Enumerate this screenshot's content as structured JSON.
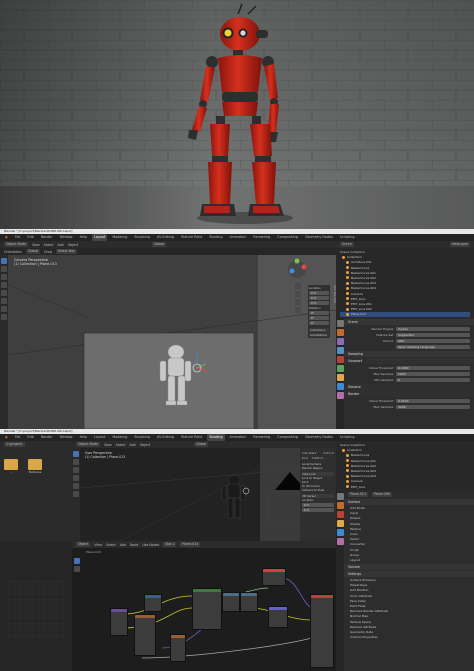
{
  "render_panel": {
    "colors": {
      "wall": "#666868",
      "robot": "#c4261a",
      "robot_dark": "#2e2e2e",
      "eye": "#f2d230"
    }
  },
  "window1": {
    "title": "Blender* [C:\\project\\Blender\\ROBO.W0.blend]",
    "menus": [
      "File",
      "Edit",
      "Render",
      "Window",
      "Help"
    ],
    "tabs": [
      "Layout",
      "Modeling",
      "Sculpting",
      "UV Editing",
      "Texture Paint",
      "Shading",
      "Animation",
      "Rendering",
      "Compositing",
      "Geometry Nodes",
      "Scripting"
    ],
    "active_tab": "Layout",
    "header": {
      "mode": "Object Mode",
      "view": "View",
      "select": "Select",
      "add": "Add",
      "object": "Object",
      "orientation": "Global"
    },
    "subheader": {
      "orientation": "Orientation",
      "default": "Global",
      "drag": "Drag",
      "select_box": "Select Box"
    },
    "viewport_overlay": {
      "line1": "Camera Perspective",
      "line2": "(1) Collection | Plane.013"
    },
    "outliner": {
      "header": "Scene Collection",
      "items": [
        "Collection",
        "Armature.001",
        "BezierCurve",
        "BezierCurve.001",
        "BezierCurve.002",
        "BezierCurve.003",
        "BezierCurve.004",
        "Camera",
        "EMT_Line",
        "EMT_Line.001",
        "EMT_Line.002",
        "Plane.013"
      ],
      "selected_index": 11
    },
    "scene_label": "Scene",
    "view_layer_label": "ViewLayer",
    "props": {
      "section": "Scene",
      "rows": [
        {
          "label": "Render Engine",
          "value": "Cycles"
        },
        {
          "label": "Feature Set",
          "value": "Supported"
        },
        {
          "label": "Device",
          "value": "GPU"
        },
        {
          "label": "",
          "value": "Open Shading Language"
        }
      ],
      "sampling": "Sampling",
      "viewport": "Viewport",
      "vrows": [
        {
          "label": "Noise Threshold",
          "value": "0.1000"
        },
        {
          "label": "Max Samples",
          "value": "1024"
        },
        {
          "label": "Min Samples",
          "value": "0"
        }
      ],
      "denoise": "Denoise",
      "render": "Render",
      "rrows": [
        {
          "label": "Noise Threshold",
          "value": "0.0100"
        },
        {
          "label": "Max Samples",
          "value": "4096"
        }
      ]
    },
    "npanel": {
      "location": "Location",
      "values": [
        "0 m",
        "0 m",
        "0 m"
      ],
      "rotation": "Rotation",
      "rvalues": [
        "0°",
        "0°",
        "0°"
      ],
      "tabs": [
        "Item",
        "Tool",
        "View"
      ]
    },
    "npanel_extra": [
      "Collections",
      "Annotations"
    ]
  },
  "window2": {
    "title": "Blender* [C:\\project\\Blender\\ROBO.W0.blend]",
    "menus": [
      "File",
      "Edit",
      "Render",
      "Window",
      "Help"
    ],
    "tabs": [
      "Layout",
      "Modeling",
      "Sculpting",
      "UV Editing",
      "Texture Paint",
      "Shading",
      "Animation",
      "Rendering",
      "Compositing",
      "Geometry Nodes",
      "Scripting"
    ],
    "active_tab": "Shading",
    "filebrowser": {
      "path": "C:\\project\\",
      "folders": [
        "..",
        "Textures"
      ]
    },
    "viewport_overlay": {
      "line1": "User Perspective",
      "line2": "(1) Collection | Plane.013"
    },
    "header": {
      "mode": "Object Mode",
      "view": "View",
      "select": "Select",
      "add": "Add",
      "object": "Object",
      "orientation": "Global"
    },
    "npanel": {
      "rows": [
        {
          "label": "Clip Start",
          "value": "0.01 m"
        },
        {
          "label": "End",
          "value": "1000 m"
        }
      ],
      "local_camera": "Local Camera",
      "render_region": "Render Region",
      "view_lock": "View Lock",
      "lock_to_object": "Lock to Object",
      "lock": "Lock",
      "to_3d_cursor": "To 3D Cursor",
      "camera_to_view": "Camera to View",
      "cursor_3d": "3D Cursor",
      "location": "Location",
      "loc_values": [
        "0 m",
        "0 m",
        "0 m"
      ]
    },
    "node_header": {
      "object": "Object",
      "view": "View",
      "select": "Select",
      "add": "Add",
      "node": "Node",
      "use_nodes": "Use Nodes",
      "slot": "Slot 1",
      "material": "Plane.013"
    },
    "node_crumb": "Plane.013",
    "outliner": {
      "header": "Scene Collection",
      "items": [
        "Collection",
        "BezierCurve",
        "BezierCurve.001",
        "BezierCurve.002",
        "BezierCurve.003",
        "BezierCurve.004",
        "Camera",
        "EMT_Line"
      ]
    },
    "material_props": {
      "object": "Plane.013",
      "material": "Plane.008",
      "surface": "Surface",
      "volume": "Volume",
      "settings": "Settings",
      "sections": [
        "Add Node",
        "Input",
        "Output",
        "Shader",
        "Texture",
        "Color",
        "Vector",
        "Converter",
        "Script",
        "Group",
        "Layout"
      ],
      "right_items": [
        "Surface Emission",
        "Preset Keys",
        "Add Position",
        "Color Attribute",
        "Face Index",
        "Point Fade",
        "Remove Render Attribute",
        "Normal Map",
        "Texture Space",
        "Remove Attribute",
        "Geometry Data",
        "Custom Properties"
      ]
    }
  }
}
